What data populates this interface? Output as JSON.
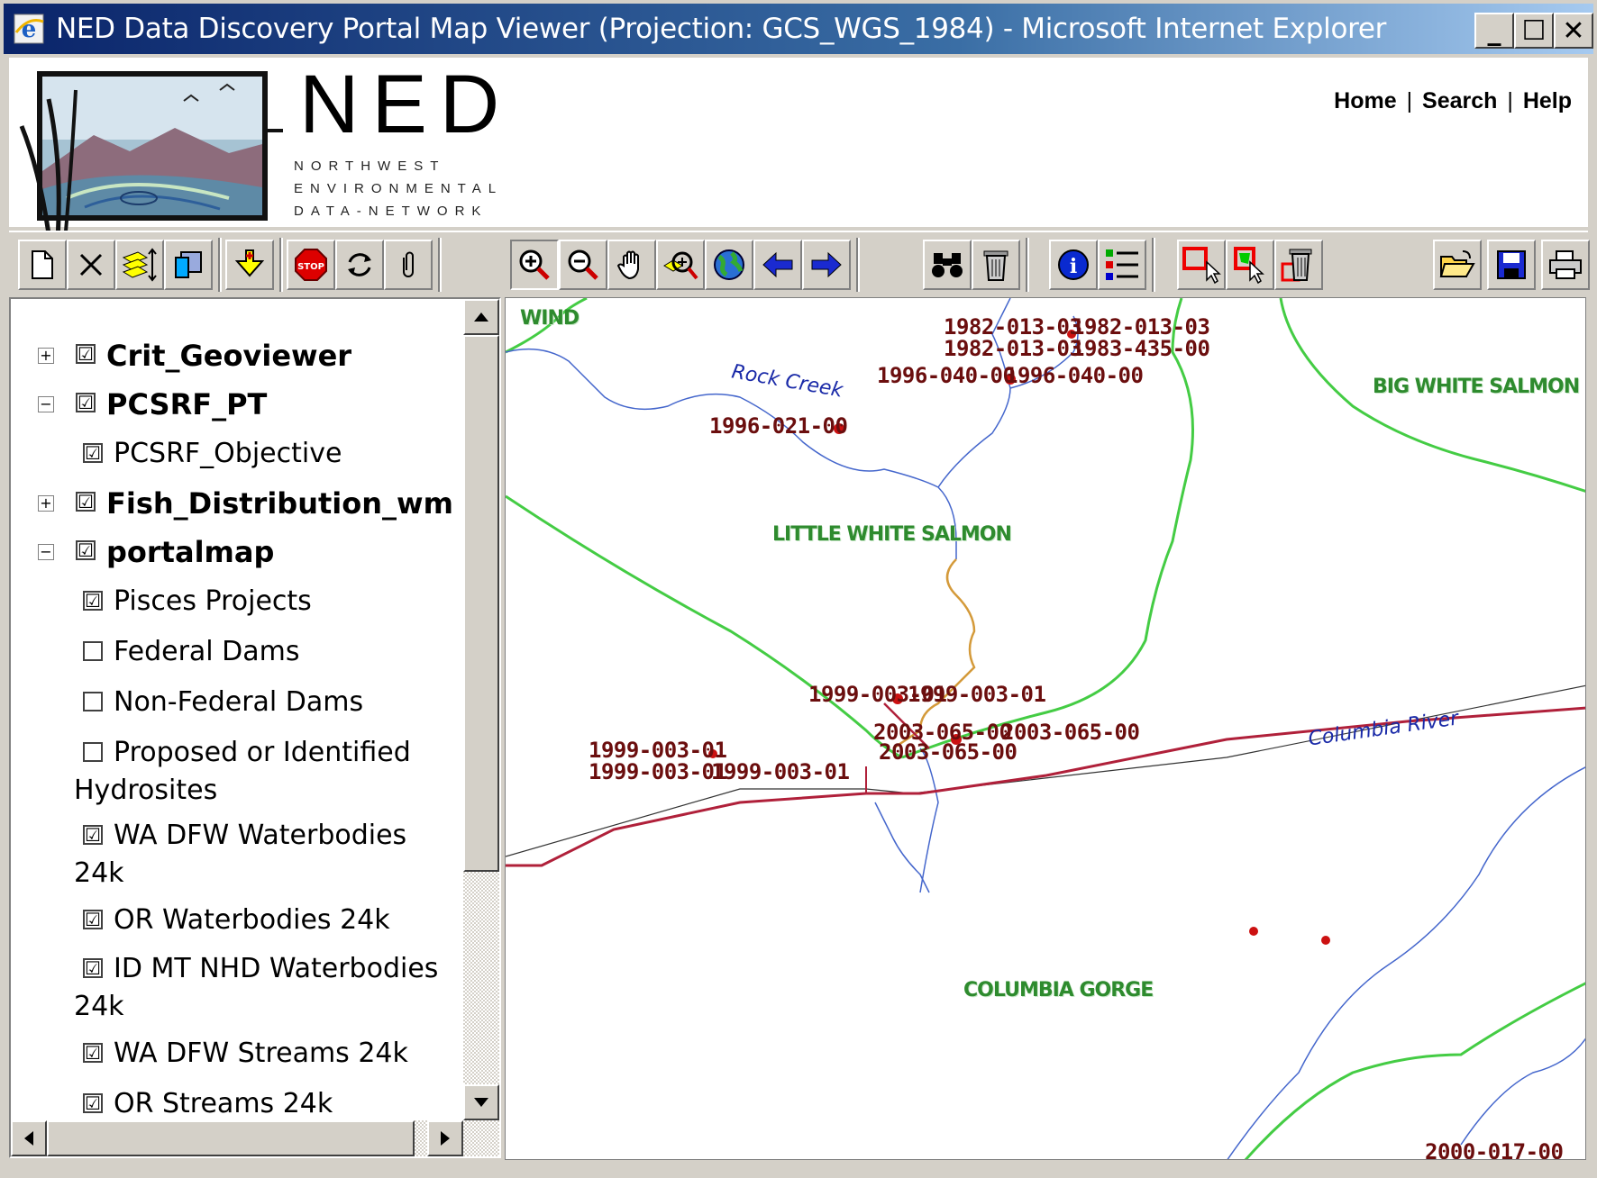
{
  "window": {
    "title": "NED Data Discovery Portal Map Viewer (Projection: GCS_WGS_1984) - Microsoft Internet Explorer",
    "controls": {
      "minimize": "_",
      "maximize": "☐",
      "close": "✕"
    }
  },
  "header": {
    "logo_text": "NED",
    "logo_sub1": "NORTHWEST",
    "logo_sub2": "ENVIRONMENTAL",
    "logo_sub3": "DATA-NETWORK",
    "links": {
      "home": "Home",
      "sep1": "|",
      "search": "Search",
      "sep2": "|",
      "help": "Help"
    }
  },
  "toolbar": {
    "icons": [
      "new-document-icon",
      "delete-icon",
      "layer-order-icon",
      "layer-properties-icon",
      "add-layer-icon",
      "stop-icon",
      "refresh-icon",
      "attach-icon",
      "zoom-in-icon",
      "zoom-out-icon",
      "pan-icon",
      "zoom-extent-icon",
      "full-extent-globe-icon",
      "back-arrow-icon",
      "forward-arrow-icon",
      "find-binoculars-icon",
      "clear-find-icon",
      "identify-info-icon",
      "legend-icon",
      "select-rectangle-icon",
      "select-feature-icon",
      "clear-selection-icon",
      "open-folder-icon",
      "save-icon",
      "print-icon"
    ],
    "stop_label": "STOP"
  },
  "layers": [
    {
      "label": "Crit_Geoviewer",
      "checked": "☑",
      "expander": "+",
      "bold": true
    },
    {
      "label": "PCSRF_PT",
      "checked": "☑",
      "expander": "−",
      "bold": true
    },
    {
      "label": "PCSRF_Objective",
      "checked": "☑"
    },
    {
      "label": "Fish_Distribution_wm",
      "checked": "☑",
      "expander": "+",
      "bold": true
    },
    {
      "label": "portalmap",
      "checked": "☑",
      "expander": "−",
      "bold": true
    },
    {
      "label": "Pisces Projects",
      "checked": "☑"
    },
    {
      "label": "Federal Dams",
      "checked": ""
    },
    {
      "label": "Non-Federal Dams",
      "checked": ""
    },
    {
      "label": "Proposed or Identified",
      "label2": "Hydrosites",
      "checked": ""
    },
    {
      "label": "WA DFW Waterbodies",
      "label2": "24k",
      "checked": "☑"
    },
    {
      "label": "OR Waterbodies 24k",
      "checked": "☑"
    },
    {
      "label": "ID MT NHD Waterbodies",
      "label2": "24k",
      "checked": "☑"
    },
    {
      "label": "WA DFW Streams 24k",
      "checked": "☑"
    },
    {
      "label": "OR Streams 24k",
      "checked": "☑"
    }
  ],
  "map": {
    "regions": [
      "WIND",
      "BIG WHITE SALMON",
      "LITTLE WHITE SALMON",
      "COLUMBIA GORGE"
    ],
    "rivers": [
      "Rock Creek",
      "Columbia River"
    ],
    "projects": [
      "1982-013-03",
      "1982-013-03",
      "1982-013-03",
      "1983-435-00",
      "1996-040-00",
      "1996-040-00",
      "1996-021-00",
      "1999-003-01",
      "1999-003-01",
      "2003-065-00",
      "2003-065-00",
      "2003-065-00",
      "1999-003-01",
      "1999-003-01",
      "1999-003-01",
      "2000-017-00"
    ],
    "colors": {
      "boundary": "#44cc44",
      "stream": "#4466cc",
      "project": "#cc1111",
      "road": "#b0203a",
      "trail": "#d49a3a"
    }
  }
}
